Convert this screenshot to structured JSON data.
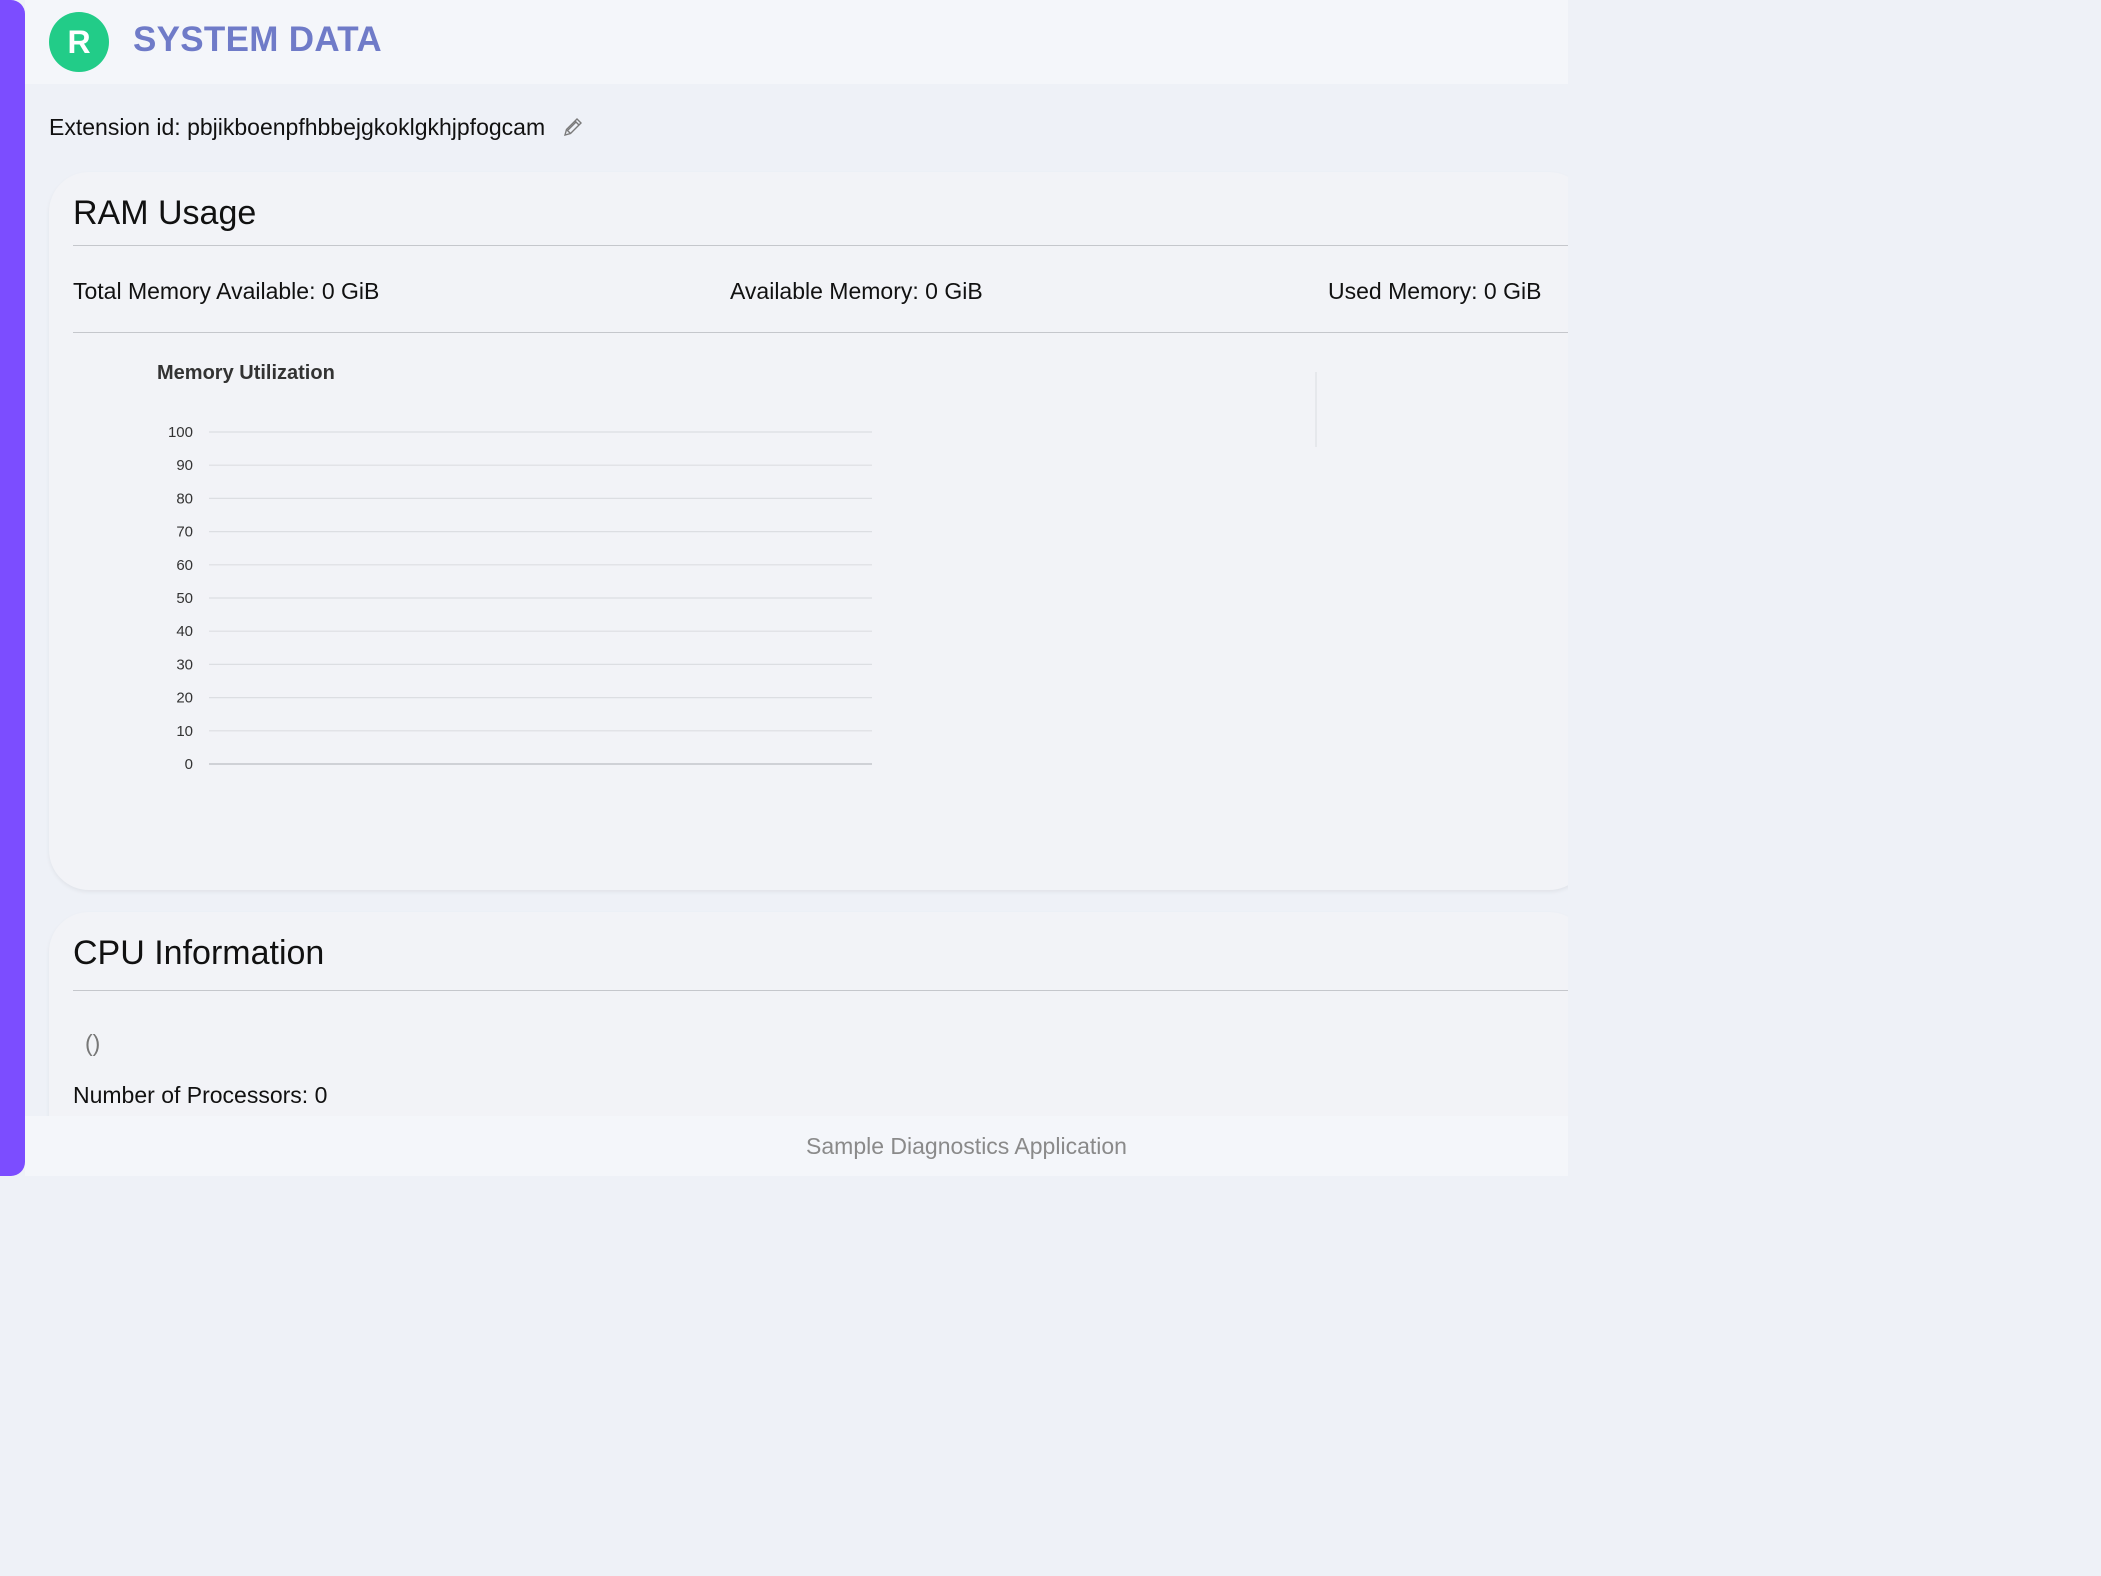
{
  "header": {
    "logo_letter": "R",
    "title": "SYSTEM DATA"
  },
  "extension": {
    "label": "Extension id: pbjikboenpfhbbejgkoklgkhjpfogcam"
  },
  "ram": {
    "title": "RAM Usage",
    "total": "Total Memory Available: 0 GiB",
    "available": "Available Memory: 0 GiB",
    "used": "Used Memory: 0 GiB"
  },
  "chart_data": {
    "type": "line",
    "title": "Memory Utilization",
    "xlabel": "",
    "ylabel": "",
    "ylim": [
      0,
      100
    ],
    "yticks": [
      100,
      90,
      80,
      70,
      60,
      50,
      40,
      30,
      20,
      10,
      0
    ],
    "categories": [],
    "series": []
  },
  "cpu": {
    "title": "CPU Information",
    "model": "()",
    "processors": "Number of Processors: 0"
  },
  "footer": {
    "text": "Sample Diagnostics Application"
  },
  "colors": {
    "accent": "#7c4dff",
    "logo": "#22cc88",
    "title": "#6f7bc8"
  },
  "icons": {
    "edit": "pencil-icon"
  }
}
